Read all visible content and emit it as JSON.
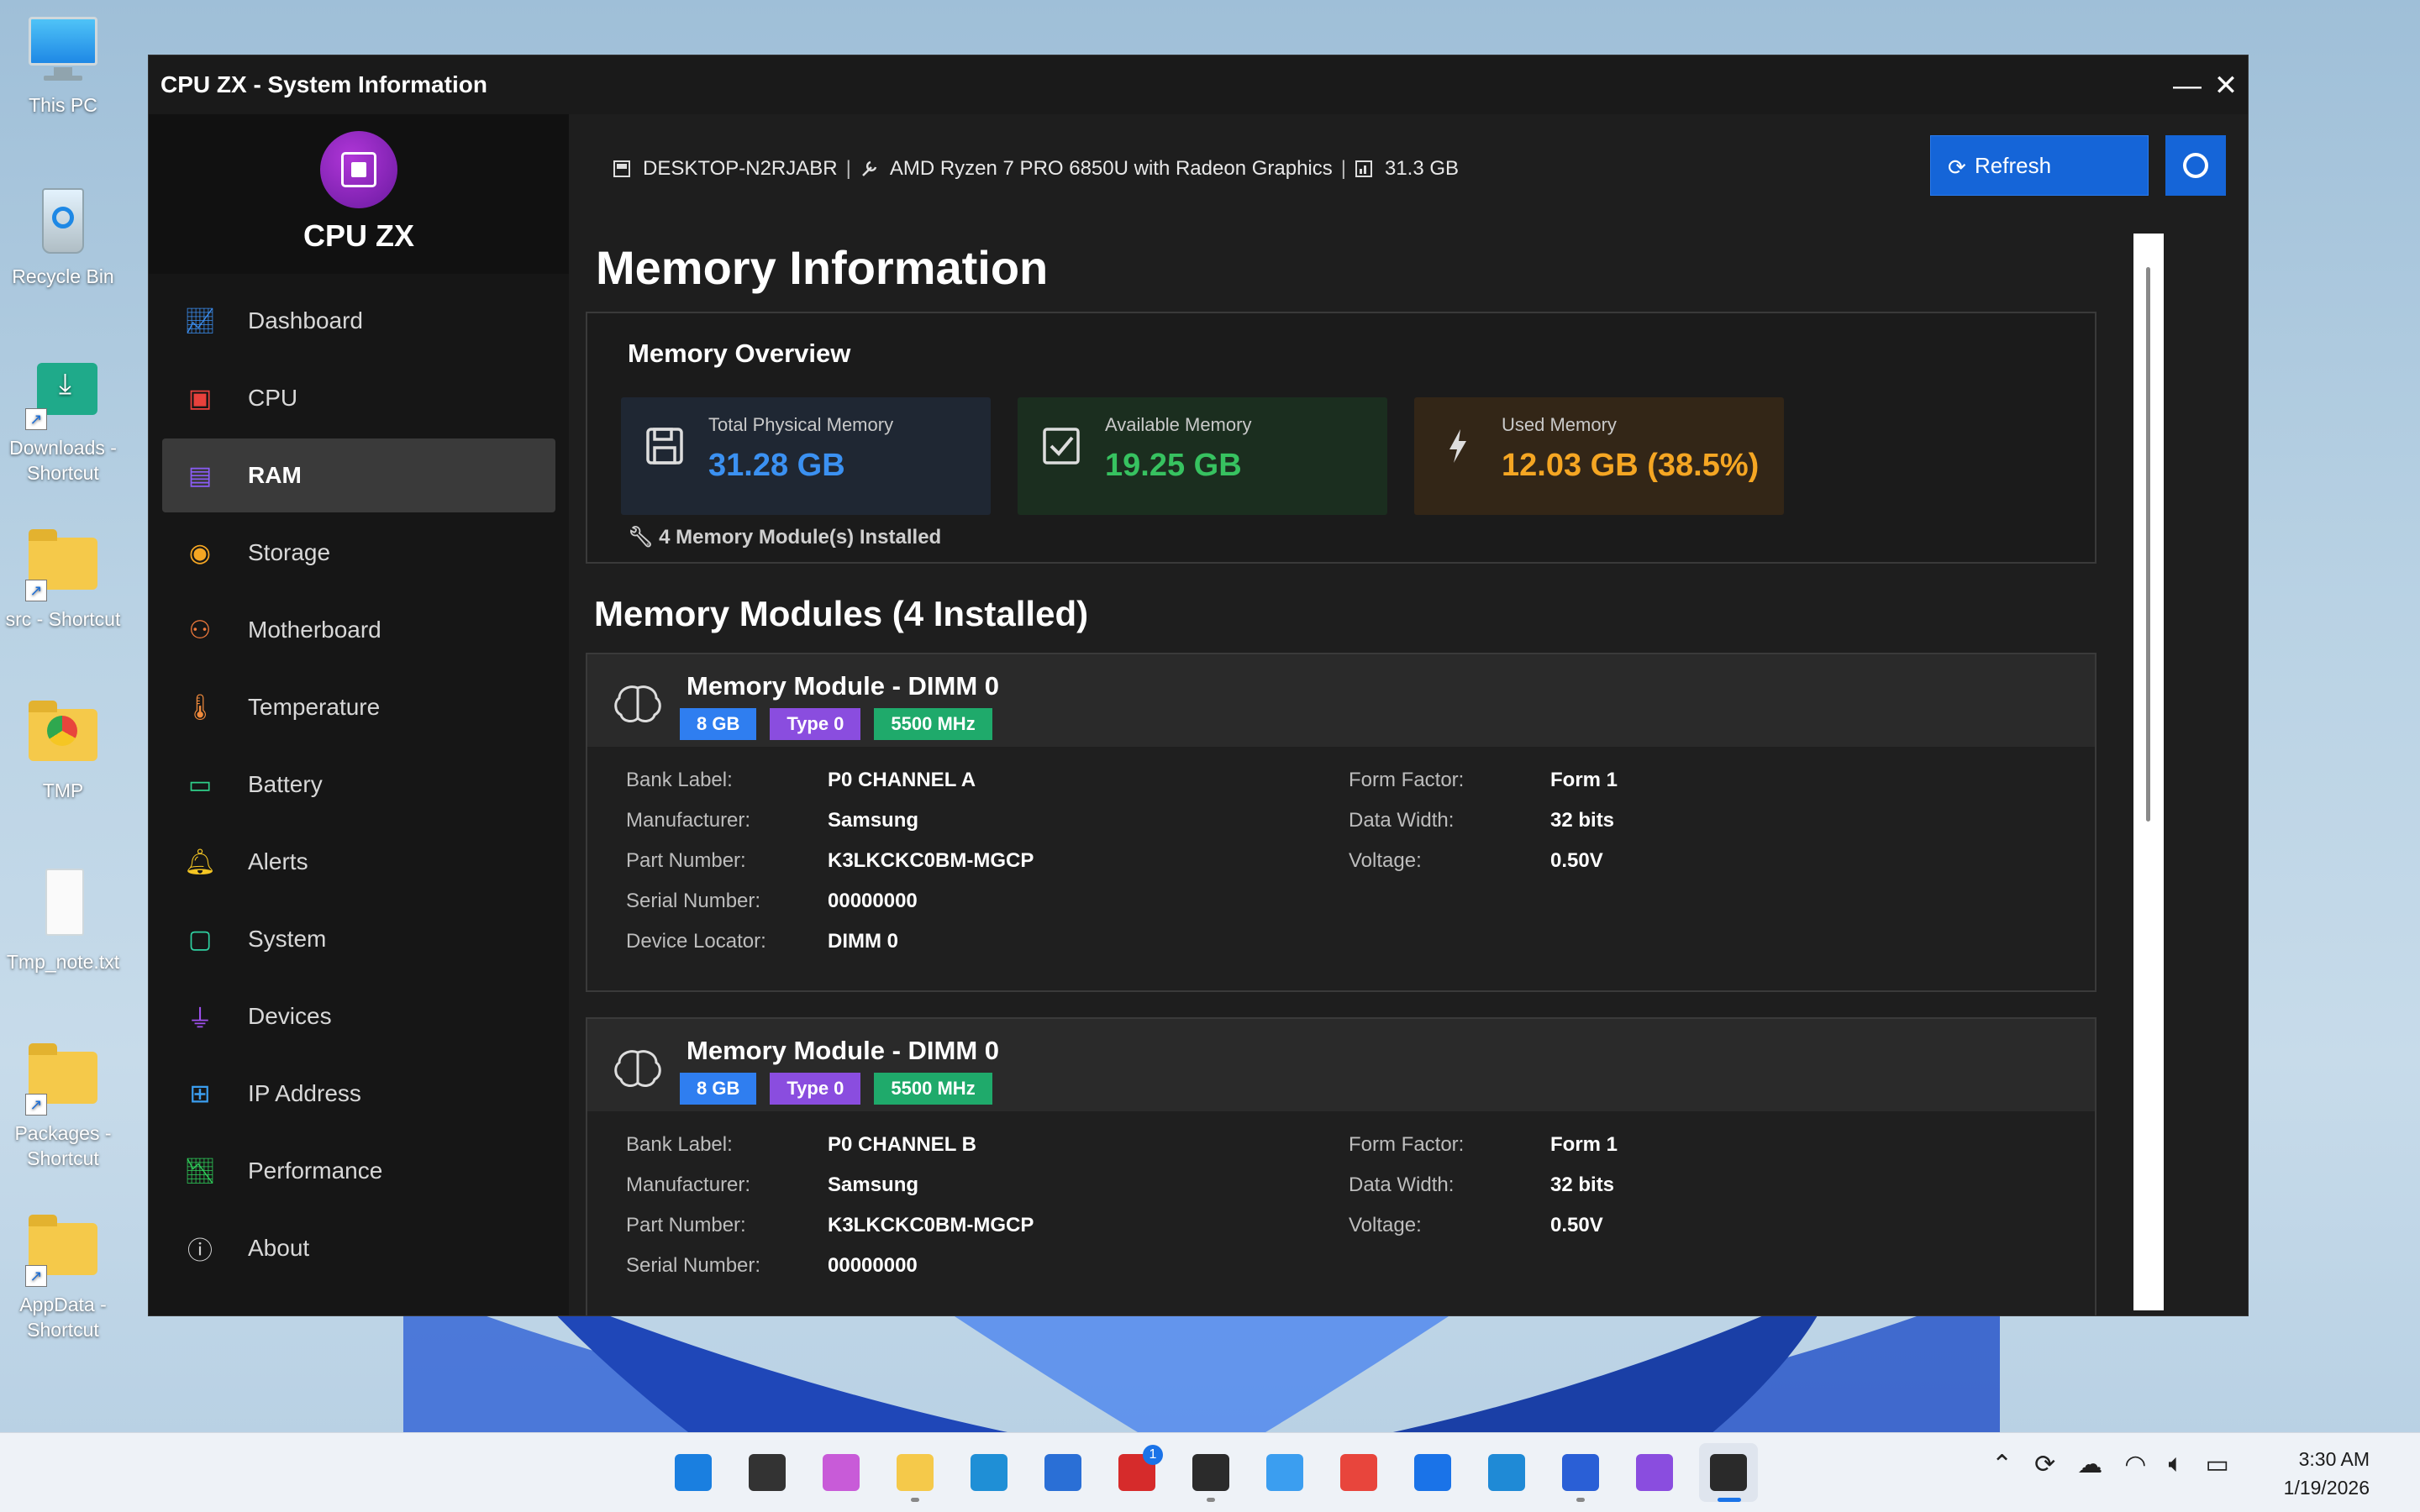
{
  "desktop": {
    "icons": [
      {
        "label": "This PC"
      },
      {
        "label": "Recycle Bin"
      },
      {
        "label": "Downloads - Shortcut"
      },
      {
        "label": "src - Shortcut"
      },
      {
        "label": "TMP"
      },
      {
        "label": "Tmp_note.txt"
      },
      {
        "label": "Packages - Shortcut"
      },
      {
        "label": "AppData - Shortcut"
      }
    ]
  },
  "window": {
    "title": "CPU ZX - System Information",
    "minimize_glyph": "—",
    "close_glyph": "✕"
  },
  "sidebar": {
    "brand": "CPU ZX",
    "items": [
      {
        "label": "Dashboard",
        "icon": "chart-line-icon",
        "color": "#3b8ef0"
      },
      {
        "label": "CPU",
        "icon": "cpu-chip-icon",
        "color": "#e8413c"
      },
      {
        "label": "RAM",
        "icon": "ram-icon",
        "color": "#8a5cf5",
        "active": true
      },
      {
        "label": "Storage",
        "icon": "database-icon",
        "color": "#f5a623"
      },
      {
        "label": "Motherboard",
        "icon": "sitemap-icon",
        "color": "#f07a3c"
      },
      {
        "label": "Temperature",
        "icon": "thermometer-icon",
        "color": "#f08a3c"
      },
      {
        "label": "Battery",
        "icon": "battery-icon",
        "color": "#2fcf8a"
      },
      {
        "label": "Alerts",
        "icon": "bell-icon",
        "color": "#f5c623"
      },
      {
        "label": "System",
        "icon": "monitor-icon",
        "color": "#2fcfa0"
      },
      {
        "label": "Devices",
        "icon": "plug-icon",
        "color": "#a050f0"
      },
      {
        "label": "IP Address",
        "icon": "network-icon",
        "color": "#3b9ef0"
      },
      {
        "label": "Performance",
        "icon": "chart-area-icon",
        "color": "#2fcf5a"
      },
      {
        "label": "About",
        "icon": "info-icon",
        "color": "#d0d0d0"
      }
    ]
  },
  "topbar": {
    "hostname": "DESKTOP-N2RJABR",
    "cpu": "AMD Ryzen 7 PRO 6850U with Radeon Graphics",
    "ram": "31.3 GB",
    "separator": "|",
    "refresh_label": "Refresh"
  },
  "page": {
    "title": "Memory Information",
    "overview": {
      "heading": "Memory Overview",
      "total_label": "Total Physical Memory",
      "total_value": "31.28 GB",
      "available_label": "Available Memory",
      "available_value": "19.25 GB",
      "used_label": "Used Memory",
      "used_value": "12.03 GB (38.5%)",
      "installed_note": "4 Memory Module(s) Installed"
    },
    "modules_title": "Memory Modules (4 Installed)",
    "modules": [
      {
        "title": "Memory Module - DIMM 0",
        "badges": [
          "8 GB",
          "Type 0",
          "5500 MHz"
        ],
        "left": [
          {
            "k": "Bank Label:",
            "v": "P0 CHANNEL A"
          },
          {
            "k": "Manufacturer:",
            "v": "Samsung"
          },
          {
            "k": "Part Number:",
            "v": "K3LKCKC0BM-MGCP"
          },
          {
            "k": "Serial Number:",
            "v": "00000000"
          },
          {
            "k": "Device Locator:",
            "v": "DIMM 0"
          }
        ],
        "right": [
          {
            "k": "Form Factor:",
            "v": "Form 1"
          },
          {
            "k": "Data Width:",
            "v": "32 bits"
          },
          {
            "k": "Voltage:",
            "v": "0.50V"
          }
        ]
      },
      {
        "title": "Memory Module - DIMM 0",
        "badges": [
          "8 GB",
          "Type 0",
          "5500 MHz"
        ],
        "left": [
          {
            "k": "Bank Label:",
            "v": "P0 CHANNEL B"
          },
          {
            "k": "Manufacturer:",
            "v": "Samsung"
          },
          {
            "k": "Part Number:",
            "v": "K3LKCKC0BM-MGCP"
          },
          {
            "k": "Serial Number:",
            "v": "00000000"
          }
        ],
        "right": [
          {
            "k": "Form Factor:",
            "v": "Form 1"
          },
          {
            "k": "Data Width:",
            "v": "32 bits"
          },
          {
            "k": "Voltage:",
            "v": "0.50V"
          }
        ]
      }
    ]
  },
  "taskbar": {
    "apps": [
      {
        "name": "start-icon",
        "color": "#1a7fe0"
      },
      {
        "name": "task-view-icon",
        "color": "#333333"
      },
      {
        "name": "copilot-icon",
        "color": "#c85bd8"
      },
      {
        "name": "file-explorer-icon",
        "color": "#f5c94a"
      },
      {
        "name": "edge-icon",
        "color": "#1f8fd6"
      },
      {
        "name": "store-icon",
        "color": "#2a6fd6"
      },
      {
        "name": "app-l-icon",
        "color": "#d62b2b",
        "badge": "1"
      },
      {
        "name": "terminal-icon",
        "color": "#2b2b2b"
      },
      {
        "name": "control-panel-icon",
        "color": "#3b9ef0"
      },
      {
        "name": "chrome-icon",
        "color": "#e8453c"
      },
      {
        "name": "app-z-icon",
        "color": "#1a73e8"
      },
      {
        "name": "vscode-icon",
        "color": "#1f8ad6"
      },
      {
        "name": "network-app-icon",
        "color": "#2a5fd6"
      },
      {
        "name": "visual-studio-icon",
        "color": "#8a4ddf"
      },
      {
        "name": "cpu-zx-app-icon",
        "color": "#2a2a2a",
        "active": true
      }
    ],
    "tray": [
      "chevron-up-icon",
      "sync-icon",
      "onedrive-icon",
      "wifi-icon",
      "volume-icon",
      "battery-icon"
    ],
    "time": "3:30 AM",
    "date": "1/19/2026"
  }
}
